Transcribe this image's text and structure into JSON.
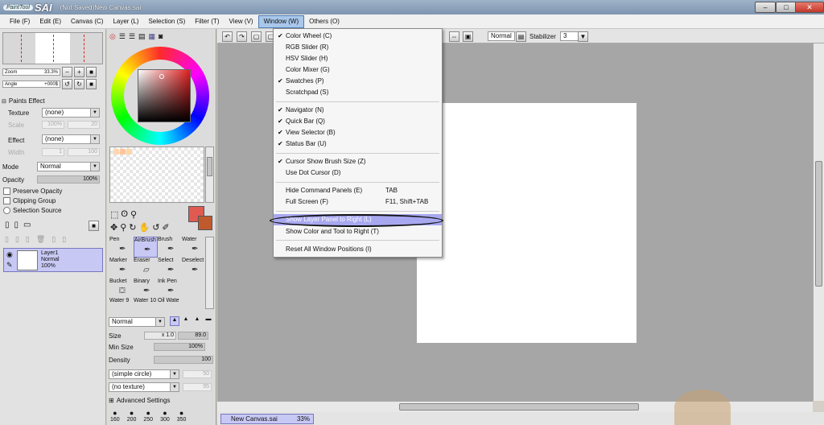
{
  "titlebar": {
    "logo_small": "PaintTool",
    "logo_big": "SAI",
    "title": "(Not Saved)New Canvas.sai",
    "minimize": "–",
    "maximize": "□",
    "close": "✕"
  },
  "menubar": {
    "items": [
      "File (F)",
      "Edit (E)",
      "Canvas (C)",
      "Layer (L)",
      "Selection (S)",
      "Filter (T)",
      "View (V)",
      "Window (W)",
      "Others (O)"
    ]
  },
  "navigator": {
    "zoom_label": "Zoom",
    "zoom_value": "33.3%",
    "angle_label": "Angle",
    "angle_value": "+000$"
  },
  "layer_panel": {
    "paints_effect": "Paints Effect",
    "texture_label": "Texture",
    "texture_value": "(none)",
    "scale_label": "Scale",
    "scale_value": "100%",
    "scale_num": "20",
    "effect_label": "Effect",
    "effect_value": "(none)",
    "width_label": "Width",
    "width_value": "1",
    "width_num": "100",
    "mode_label": "Mode",
    "mode_value": "Normal",
    "opacity_label": "Opacity",
    "opacity_value": "100%",
    "preserve_opacity": "Preserve Opacity",
    "clipping_group": "Clipping Group",
    "selection_source": "Selection Source",
    "layer_name": "Layer1",
    "layer_mode": "Normal",
    "layer_opacity": "100%"
  },
  "tools": {
    "cells": [
      {
        "label": "Pen",
        "icon": "pen-icon"
      },
      {
        "label": "AirBrush",
        "icon": "airbrush-icon"
      },
      {
        "label": "Brush",
        "icon": "brush-icon"
      },
      {
        "label": "Water",
        "icon": "water-icon"
      },
      {
        "label": "Marker",
        "icon": "marker-icon"
      },
      {
        "label": "Eraser",
        "icon": "eraser-icon"
      },
      {
        "label": "Select",
        "icon": "select-icon"
      },
      {
        "label": "Deselect",
        "icon": "deselect-icon"
      },
      {
        "label": "Bucket",
        "icon": "bucket-icon"
      },
      {
        "label": "Binary",
        "icon": "binary-icon"
      },
      {
        "label": "Ink Pen",
        "icon": "ink-pen-icon"
      },
      {
        "label": "",
        "icon": ""
      },
      {
        "label": "Water 9",
        "icon": "water-icon"
      },
      {
        "label": "Water 10",
        "icon": "water-icon"
      },
      {
        "label": "Oil Wate",
        "icon": "oil-water-icon"
      },
      {
        "label": "",
        "icon": ""
      }
    ],
    "blend_mode": "Normal",
    "size_label": "Size",
    "size_mult": "x 1.0",
    "size_value": "89.0",
    "min_size_label": "Min Size",
    "min_size_value": "100%",
    "density_label": "Density",
    "density_value": "100",
    "shape": "(simple circle)",
    "shape_num": "50",
    "texture": "(no texture)",
    "texture_num": "95",
    "advanced": "Advanced Settings",
    "brush_sizes": [
      "160",
      "200",
      "250",
      "300",
      "350"
    ]
  },
  "toolbar": {
    "mode": "Normal",
    "stabilizer_label": "Stabilizer",
    "stabilizer_value": "3"
  },
  "status": {
    "doc_name": "New Canvas.sai",
    "doc_zoom": "33%"
  },
  "window_menu": {
    "items": [
      {
        "label": "Color Wheel (C)",
        "checked": "✔",
        "shortcut": ""
      },
      {
        "label": "RGB Slider (R)",
        "checked": "",
        "shortcut": ""
      },
      {
        "label": "HSV Slider (H)",
        "checked": "",
        "shortcut": ""
      },
      {
        "label": "Color Mixer (G)",
        "checked": "",
        "shortcut": ""
      },
      {
        "label": "Swatches (P)",
        "checked": "✔",
        "shortcut": ""
      },
      {
        "label": "Scratchpad (S)",
        "checked": "",
        "shortcut": ""
      },
      {
        "label": "Navigator (N)",
        "checked": "✔",
        "shortcut": ""
      },
      {
        "label": "Quick Bar (Q)",
        "checked": "✔",
        "shortcut": ""
      },
      {
        "label": "View Selector (B)",
        "checked": "✔",
        "shortcut": ""
      },
      {
        "label": "Status Bar (U)",
        "checked": "✔",
        "shortcut": ""
      },
      {
        "label": "Cursor Show Brush Size (Z)",
        "checked": "✔",
        "shortcut": ""
      },
      {
        "label": "Use Dot Cursor (D)",
        "checked": "",
        "shortcut": ""
      },
      {
        "label": "Hide Command Panels (E)",
        "checked": "",
        "shortcut": "TAB"
      },
      {
        "label": "Full Screen (F)",
        "checked": "",
        "shortcut": "F11, Shift+TAB"
      },
      {
        "label": "Show Layer Panel to Right (L)",
        "checked": "",
        "shortcut": ""
      },
      {
        "label": "Show Color and Tool to Right (T)",
        "checked": "",
        "shortcut": ""
      },
      {
        "label": "Reset All Window Positions (I)",
        "checked": "",
        "shortcut": ""
      }
    ]
  }
}
